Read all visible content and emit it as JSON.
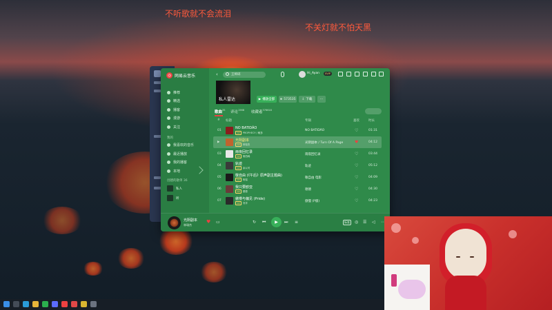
{
  "desktop": {
    "lyric_left": "不听歌就不会流泪",
    "lyric_right": "不关灯就不怕天黑"
  },
  "app": {
    "name": "网易云音乐",
    "search_placeholder": "王稀碎",
    "user": "Hi_Ayan",
    "vip_badge": "SVIP"
  },
  "sidebar": {
    "items": [
      "推荐",
      "精选",
      "播客",
      "漫游",
      "关注"
    ],
    "section_mine": "我的",
    "my_items": [
      "我喜欢的音乐",
      "最近播放",
      "我的播客",
      "本地"
    ],
    "section_created": "创建的歌单 36",
    "playlists": [
      "私人",
      "听"
    ]
  },
  "playlist": {
    "cover_title": "私人雷达",
    "play_all": "播放全部",
    "collect": "573535",
    "download": "下载",
    "more": "···"
  },
  "tabs": [
    {
      "label": "歌曲",
      "count": "35"
    },
    {
      "label": "评论",
      "count": "1568"
    },
    {
      "label": "收藏者",
      "count": "376618"
    }
  ],
  "table_headers": {
    "index": "#",
    "title": "标题",
    "album": "专辑",
    "like": "喜欢",
    "duration": "时长"
  },
  "tracks": [
    {
      "idx": "01",
      "title": "NO BATIDÃO",
      "artist": "PROPHECY / 敏多",
      "tag": "VIP",
      "album": "NO BATIDÃO",
      "liked": false,
      "duration": "01:31"
    },
    {
      "idx": "02",
      "title": "光阴副本",
      "artist": "林瑞杰",
      "tag": "VIP",
      "album": "光阴副本 / Turn Of A Page",
      "liked": true,
      "duration": "04:12"
    },
    {
      "idx": "03",
      "title": "雨夜回忆录",
      "artist": "胡西韩",
      "tag": "VIP",
      "album": "雨夜回忆录",
      "liked": false,
      "duration": "03:44"
    },
    {
      "idx": "04",
      "title": "轨迹",
      "artist": "余以可",
      "tag": "VIP",
      "album": "轨迹",
      "liked": false,
      "duration": "05:12"
    },
    {
      "idx": "05",
      "title": "敬自由 (《午后》原声副主题曲)",
      "artist": "阿瑞",
      "tag": "VIP",
      "album": "敬自由 电影",
      "liked": false,
      "duration": "04:09"
    },
    {
      "idx": "06",
      "title": "我只要欧亚",
      "artist": "德德",
      "tag": "VIP",
      "album": "德德",
      "liked": false,
      "duration": "04:30"
    },
    {
      "idx": "07",
      "title": "傲慢与偏见 (Pride)",
      "artist": "刘洋",
      "tag": "VIP",
      "album": "傲慢 (P版)",
      "liked": false,
      "duration": "04:23"
    }
  ],
  "player": {
    "now_title": "光阴副本",
    "now_artist": "林瑞杰",
    "quality": "标准",
    "prev": "⏮",
    "play": "▶",
    "next": "⏭"
  },
  "colors": {
    "app_bg": "#2f8a4a",
    "accent_red": "#ec4141",
    "play_green": "#38b05a",
    "lyric": "#ff5a3c"
  }
}
